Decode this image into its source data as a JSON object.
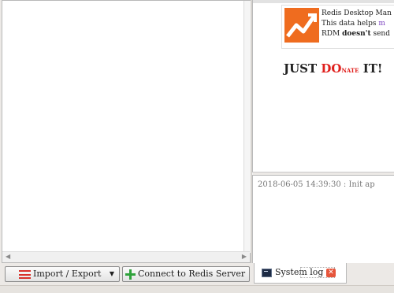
{
  "promo": {
    "line1": "Redis Desktop Man",
    "line2_prefix": "This data helps ",
    "line2_cut": "m",
    "line3_prefix": "RDM ",
    "line3_bold": "doesn't",
    "line3_suffix": " send"
  },
  "donate": {
    "part1": "JUST ",
    "part2": "DO",
    "part3": "NATE",
    "part4": " IT!"
  },
  "log": {
    "entry": "2018-06-05 14:39:30 : Init ap"
  },
  "toolbar": {
    "import_export_label": "Import / Export",
    "connect_label": "Connect to Redis Server"
  },
  "tabs": {
    "system_log_label": "System log"
  },
  "colors": {
    "logo_orange": "#ef6c1f",
    "donate_red": "#e0201d",
    "connect_plus_green": "#2fa23b"
  }
}
